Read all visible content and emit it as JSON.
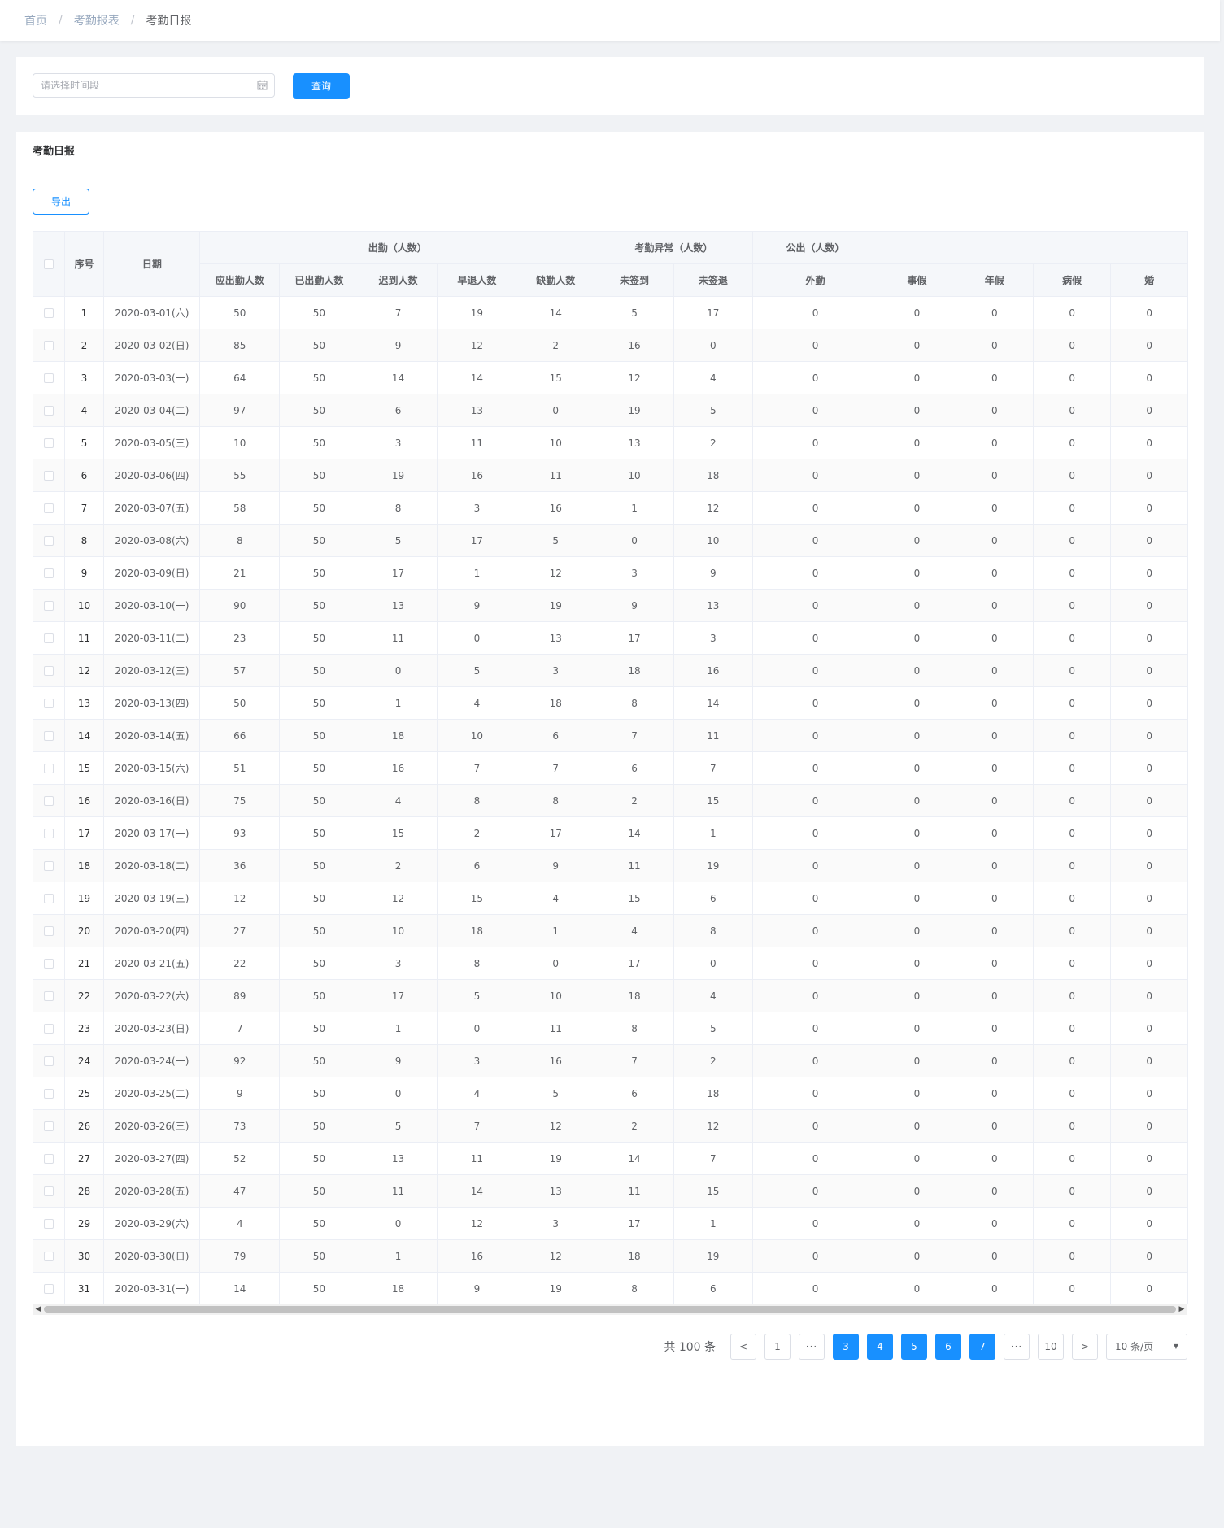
{
  "breadcrumb": [
    "首页",
    "考勤报表",
    "考勤日报"
  ],
  "filter": {
    "date_placeholder": "请选择时间段",
    "query_label": "查询"
  },
  "panel": {
    "title": "考勤日报",
    "export_label": "导出"
  },
  "table": {
    "idx_header": "序号",
    "date_header": "日期",
    "groups": [
      {
        "label": "出勤（人数）",
        "span": 5
      },
      {
        "label": "考勤异常（人数）",
        "span": 2
      },
      {
        "label": "公出（人数）",
        "span": 1
      },
      {
        "label": "",
        "span": 4
      }
    ],
    "columns": [
      "应出勤人数",
      "已出勤人数",
      "迟到人数",
      "早退人数",
      "缺勤人数",
      "未签到",
      "未签退",
      "外勤",
      "事假",
      "年假",
      "病假",
      "婚"
    ],
    "rows": [
      [
        "1",
        "2020-03-01(六)",
        50,
        50,
        7,
        19,
        14,
        5,
        17,
        0,
        0,
        0,
        0,
        0
      ],
      [
        "2",
        "2020-03-02(日)",
        85,
        50,
        9,
        12,
        2,
        16,
        0,
        0,
        0,
        0,
        0,
        0
      ],
      [
        "3",
        "2020-03-03(一)",
        64,
        50,
        14,
        14,
        15,
        12,
        4,
        0,
        0,
        0,
        0,
        0
      ],
      [
        "4",
        "2020-03-04(二)",
        97,
        50,
        6,
        13,
        0,
        19,
        5,
        0,
        0,
        0,
        0,
        0
      ],
      [
        "5",
        "2020-03-05(三)",
        10,
        50,
        3,
        11,
        10,
        13,
        2,
        0,
        0,
        0,
        0,
        0
      ],
      [
        "6",
        "2020-03-06(四)",
        55,
        50,
        19,
        16,
        11,
        10,
        18,
        0,
        0,
        0,
        0,
        0
      ],
      [
        "7",
        "2020-03-07(五)",
        58,
        50,
        8,
        3,
        16,
        1,
        12,
        0,
        0,
        0,
        0,
        0
      ],
      [
        "8",
        "2020-03-08(六)",
        8,
        50,
        5,
        17,
        5,
        0,
        10,
        0,
        0,
        0,
        0,
        0
      ],
      [
        "9",
        "2020-03-09(日)",
        21,
        50,
        17,
        1,
        12,
        3,
        9,
        0,
        0,
        0,
        0,
        0
      ],
      [
        "10",
        "2020-03-10(一)",
        90,
        50,
        13,
        9,
        19,
        9,
        13,
        0,
        0,
        0,
        0,
        0
      ],
      [
        "11",
        "2020-03-11(二)",
        23,
        50,
        11,
        0,
        13,
        17,
        3,
        0,
        0,
        0,
        0,
        0
      ],
      [
        "12",
        "2020-03-12(三)",
        57,
        50,
        0,
        5,
        3,
        18,
        16,
        0,
        0,
        0,
        0,
        0
      ],
      [
        "13",
        "2020-03-13(四)",
        50,
        50,
        1,
        4,
        18,
        8,
        14,
        0,
        0,
        0,
        0,
        0
      ],
      [
        "14",
        "2020-03-14(五)",
        66,
        50,
        18,
        10,
        6,
        7,
        11,
        0,
        0,
        0,
        0,
        0
      ],
      [
        "15",
        "2020-03-15(六)",
        51,
        50,
        16,
        7,
        7,
        6,
        7,
        0,
        0,
        0,
        0,
        0
      ],
      [
        "16",
        "2020-03-16(日)",
        75,
        50,
        4,
        8,
        8,
        2,
        15,
        0,
        0,
        0,
        0,
        0
      ],
      [
        "17",
        "2020-03-17(一)",
        93,
        50,
        15,
        2,
        17,
        14,
        1,
        0,
        0,
        0,
        0,
        0
      ],
      [
        "18",
        "2020-03-18(二)",
        36,
        50,
        2,
        6,
        9,
        11,
        19,
        0,
        0,
        0,
        0,
        0
      ],
      [
        "19",
        "2020-03-19(三)",
        12,
        50,
        12,
        15,
        4,
        15,
        6,
        0,
        0,
        0,
        0,
        0
      ],
      [
        "20",
        "2020-03-20(四)",
        27,
        50,
        10,
        18,
        1,
        4,
        8,
        0,
        0,
        0,
        0,
        0
      ],
      [
        "21",
        "2020-03-21(五)",
        22,
        50,
        3,
        8,
        0,
        17,
        0,
        0,
        0,
        0,
        0,
        0
      ],
      [
        "22",
        "2020-03-22(六)",
        89,
        50,
        17,
        5,
        10,
        18,
        4,
        0,
        0,
        0,
        0,
        0
      ],
      [
        "23",
        "2020-03-23(日)",
        7,
        50,
        1,
        0,
        11,
        8,
        5,
        0,
        0,
        0,
        0,
        0
      ],
      [
        "24",
        "2020-03-24(一)",
        92,
        50,
        9,
        3,
        16,
        7,
        2,
        0,
        0,
        0,
        0,
        0
      ],
      [
        "25",
        "2020-03-25(二)",
        9,
        50,
        0,
        4,
        5,
        6,
        18,
        0,
        0,
        0,
        0,
        0
      ],
      [
        "26",
        "2020-03-26(三)",
        73,
        50,
        5,
        7,
        12,
        2,
        12,
        0,
        0,
        0,
        0,
        0
      ],
      [
        "27",
        "2020-03-27(四)",
        52,
        50,
        13,
        11,
        19,
        14,
        7,
        0,
        0,
        0,
        0,
        0
      ],
      [
        "28",
        "2020-03-28(五)",
        47,
        50,
        11,
        14,
        13,
        11,
        15,
        0,
        0,
        0,
        0,
        0
      ],
      [
        "29",
        "2020-03-29(六)",
        4,
        50,
        0,
        12,
        3,
        17,
        1,
        0,
        0,
        0,
        0,
        0
      ],
      [
        "30",
        "2020-03-30(日)",
        79,
        50,
        1,
        16,
        12,
        18,
        19,
        0,
        0,
        0,
        0,
        0
      ],
      [
        "31",
        "2020-03-31(一)",
        14,
        50,
        18,
        9,
        19,
        8,
        6,
        0,
        0,
        0,
        0,
        0
      ]
    ]
  },
  "pagination": {
    "total_text": "共 100 条",
    "prev": "<",
    "next": ">",
    "items": [
      {
        "label": "1",
        "active": false
      },
      {
        "label": "···",
        "active": false,
        "more": true
      },
      {
        "label": "3",
        "active": true
      },
      {
        "label": "4",
        "active": true
      },
      {
        "label": "5",
        "active": true
      },
      {
        "label": "6",
        "active": true
      },
      {
        "label": "7",
        "active": true
      },
      {
        "label": "···",
        "active": false,
        "more": true
      },
      {
        "label": "10",
        "active": false
      }
    ],
    "page_size": "10 条/页"
  },
  "colors": {
    "primary": "#1890ff",
    "header_bg": "#f5f7fa",
    "page_bg": "#f0f2f5"
  }
}
